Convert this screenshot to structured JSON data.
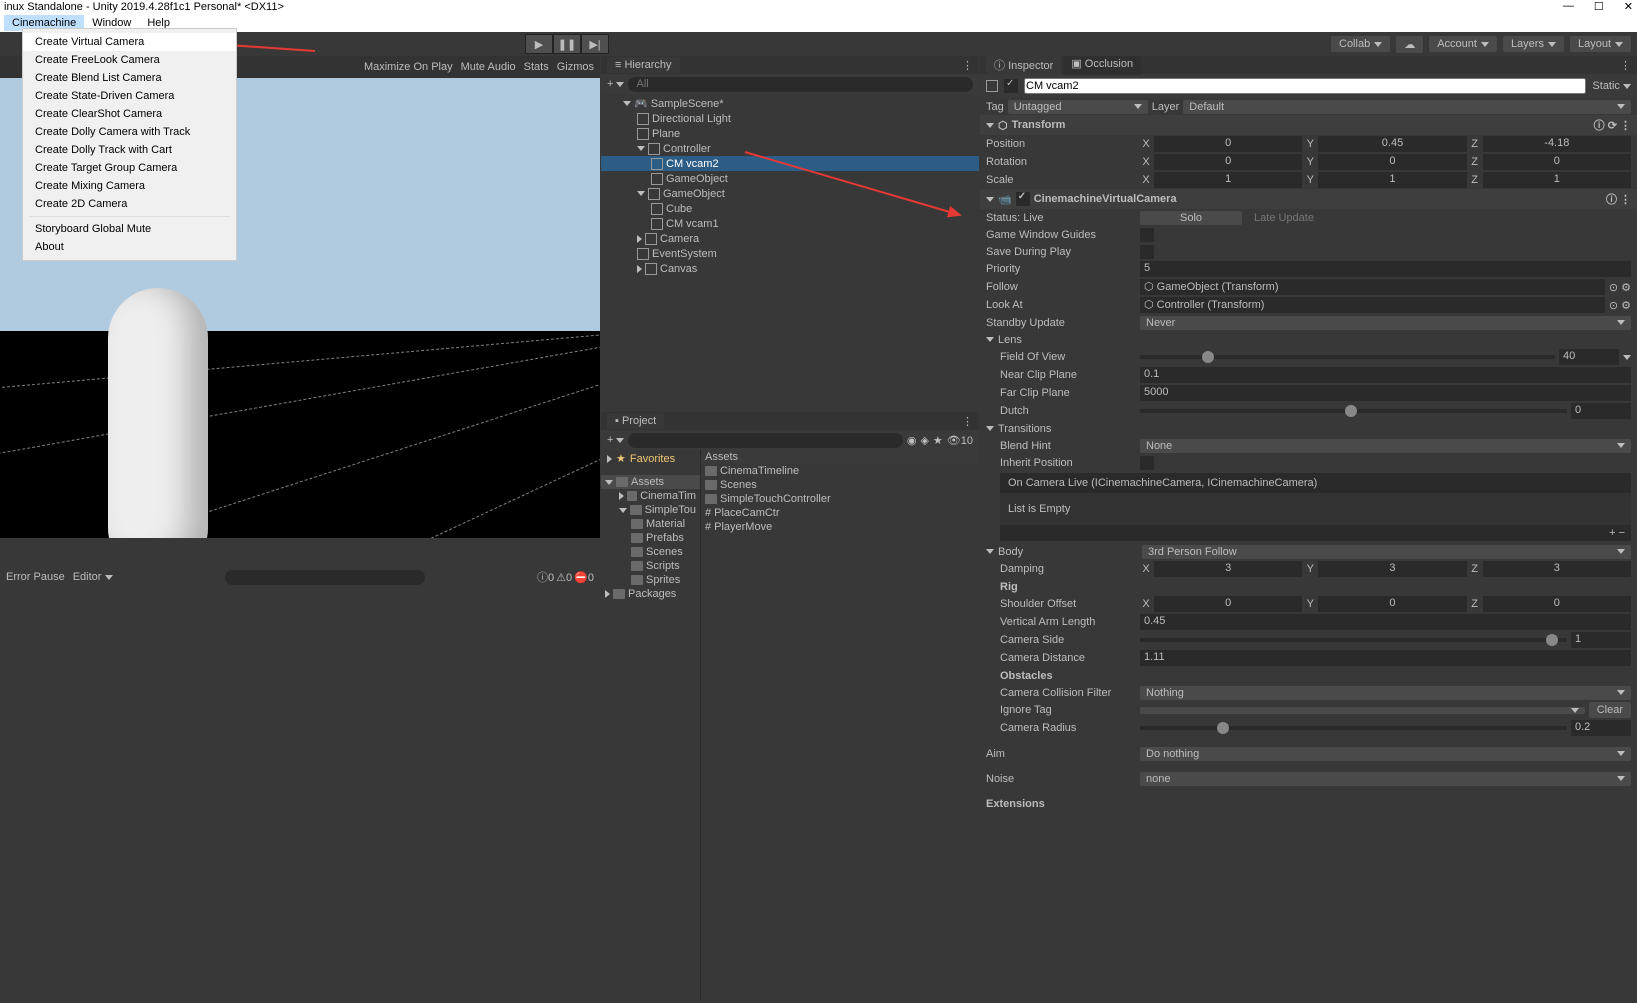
{
  "window": {
    "title": "inux Standalone - Unity 2019.4.28f1c1 Personal* <DX11>"
  },
  "menubar": {
    "items": [
      "Cinemachine",
      "Window",
      "Help"
    ]
  },
  "cinemachine_menu": {
    "items": [
      "Create Virtual Camera",
      "Create FreeLook Camera",
      "Create Blend List Camera",
      "Create State-Driven Camera",
      "Create ClearShot Camera",
      "Create Dolly Camera with Track",
      "Create Dolly Track with Cart",
      "Create Target Group Camera",
      "Create Mixing Camera",
      "Create 2D Camera"
    ],
    "after_sep": [
      "Storyboard Global Mute",
      "About"
    ]
  },
  "toolbar": {
    "collab": "Collab",
    "account": "Account",
    "layers": "Layers",
    "layout": "Layout"
  },
  "scene_toolbar": {
    "maximize": "Maximize On Play",
    "mute": "Mute Audio",
    "stats": "Stats",
    "gizmos": "Gizmos"
  },
  "hierarchy": {
    "title": "Hierarchy",
    "search_placeholder": "All",
    "scene": "SampleScene*",
    "items": [
      "Directional Light",
      "Plane",
      "Controller",
      "CM vcam2",
      "GameObject",
      "GameObject",
      "Cube",
      "CM vcam1",
      "Camera",
      "EventSystem",
      "Canvas"
    ]
  },
  "project": {
    "title": "Project",
    "favorites": "Favorites",
    "assets": "Assets",
    "packages": "Packages",
    "left_tree": [
      "CinemaTim",
      "SimpleTou",
      "Material",
      "Prefabs",
      "Scenes",
      "Scripts",
      "Sprites"
    ],
    "right_head": "Assets",
    "right_items": [
      "CinemaTimeline",
      "Scenes",
      "SimpleTouchController",
      "PlaceCamCtr",
      "PlayerMove"
    ],
    "count": "10"
  },
  "console": {
    "error_pause": "Error Pause",
    "editor": "Editor",
    "zero": "0"
  },
  "inspector": {
    "tab1": "Inspector",
    "tab2": "Occlusion",
    "object_name": "CM vcam2",
    "static": "Static",
    "tag_label": "Tag",
    "tag_value": "Untagged",
    "layer_label": "Layer",
    "layer_value": "Default",
    "transform": {
      "title": "Transform",
      "position": {
        "label": "Position",
        "x": "0",
        "y": "0.45",
        "z": "-4.18"
      },
      "rotation": {
        "label": "Rotation",
        "x": "0",
        "y": "0",
        "z": "0"
      },
      "scale": {
        "label": "Scale",
        "x": "1",
        "y": "1",
        "z": "1"
      }
    },
    "cvc": {
      "title": "CinemachineVirtualCamera",
      "status_label": "Status: Live",
      "solo": "Solo",
      "late_update": "Late Update",
      "guides": "Game Window Guides",
      "save_play": "Save During Play",
      "priority_label": "Priority",
      "priority": "5",
      "follow_label": "Follow",
      "follow": "GameObject (Transform)",
      "lookat_label": "Look At",
      "lookat": "Controller (Transform)",
      "standby_label": "Standby Update",
      "standby": "Never",
      "lens": "Lens",
      "fov_label": "Field Of View",
      "fov": "40",
      "near_label": "Near Clip Plane",
      "near": "0.1",
      "far_label": "Far Clip Plane",
      "far": "5000",
      "dutch_label": "Dutch",
      "dutch": "0",
      "transitions": "Transitions",
      "blend_label": "Blend Hint",
      "blend": "None",
      "inherit": "Inherit Position",
      "oncam": "On Camera Live (ICinemachineCamera, ICinemachineCamera)",
      "list_empty": "List is Empty",
      "body_label": "Body",
      "body": "3rd Person Follow",
      "damping_label": "Damping",
      "damping_x": "3",
      "damping_y": "3",
      "damping_z": "3",
      "rig": "Rig",
      "shoulder_label": "Shoulder Offset",
      "sh_x": "0",
      "sh_y": "0",
      "sh_z": "0",
      "arm_label": "Vertical Arm Length",
      "arm": "0.45",
      "side_label": "Camera Side",
      "side": "1",
      "dist_label": "Camera Distance",
      "dist": "1.11",
      "obstacles": "Obstacles",
      "coll_label": "Camera Collision Filter",
      "coll": "Nothing",
      "ignore_label": "Ignore Tag",
      "clear": "Clear",
      "radius_label": "Camera Radius",
      "radius": "0.2",
      "aim_label": "Aim",
      "aim": "Do nothing",
      "noise_label": "Noise",
      "noise": "none",
      "extensions": "Extensions"
    }
  }
}
